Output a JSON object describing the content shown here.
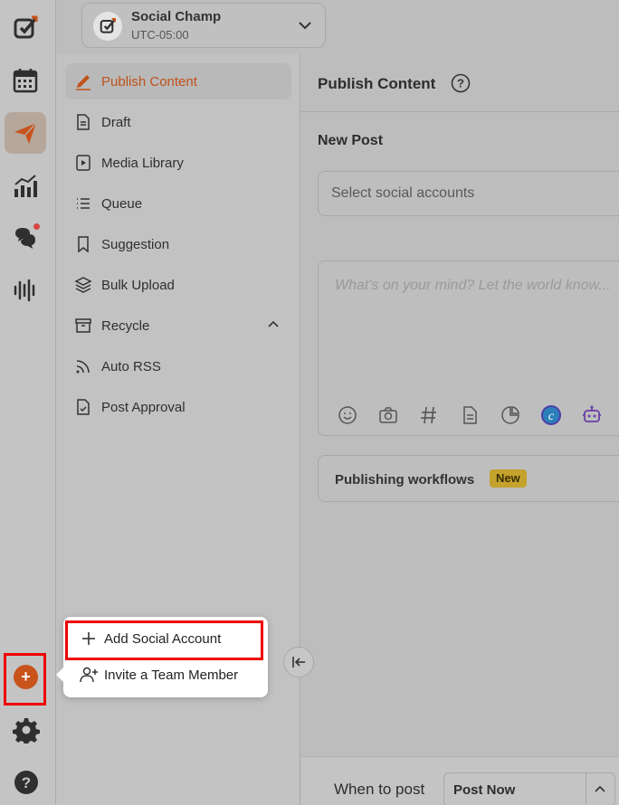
{
  "workspace": {
    "name": "Social Champ",
    "timezone": "UTC-05:00"
  },
  "subnav": {
    "items": [
      {
        "label": "Publish Content",
        "icon": "pen-icon",
        "active": true
      },
      {
        "label": "Draft",
        "icon": "document-icon"
      },
      {
        "label": "Media Library",
        "icon": "media-icon"
      },
      {
        "label": "Queue",
        "icon": "list-icon"
      },
      {
        "label": "Suggestion",
        "icon": "bookmark-icon"
      },
      {
        "label": "Bulk Upload",
        "icon": "layers-icon"
      },
      {
        "label": "Recycle",
        "icon": "archive-icon"
      },
      {
        "label": "Auto RSS",
        "icon": "rss-icon"
      },
      {
        "label": "Post Approval",
        "icon": "file-check-icon"
      }
    ]
  },
  "main": {
    "title": "Publish Content",
    "section_title": "New Post",
    "select_placeholder": "Select social accounts",
    "composer_placeholder": "What's on your mind? Let the world know...",
    "workflows_label": "Publishing workflows",
    "workflows_badge": "New",
    "when_label": "When to post",
    "post_option": "Post Now"
  },
  "popup": {
    "add_account": "Add Social Account",
    "invite_member": "Invite a Team Member"
  },
  "colors": {
    "accent": "#c8531b",
    "highlight": "#e00000",
    "badge": "#c4a22c"
  }
}
